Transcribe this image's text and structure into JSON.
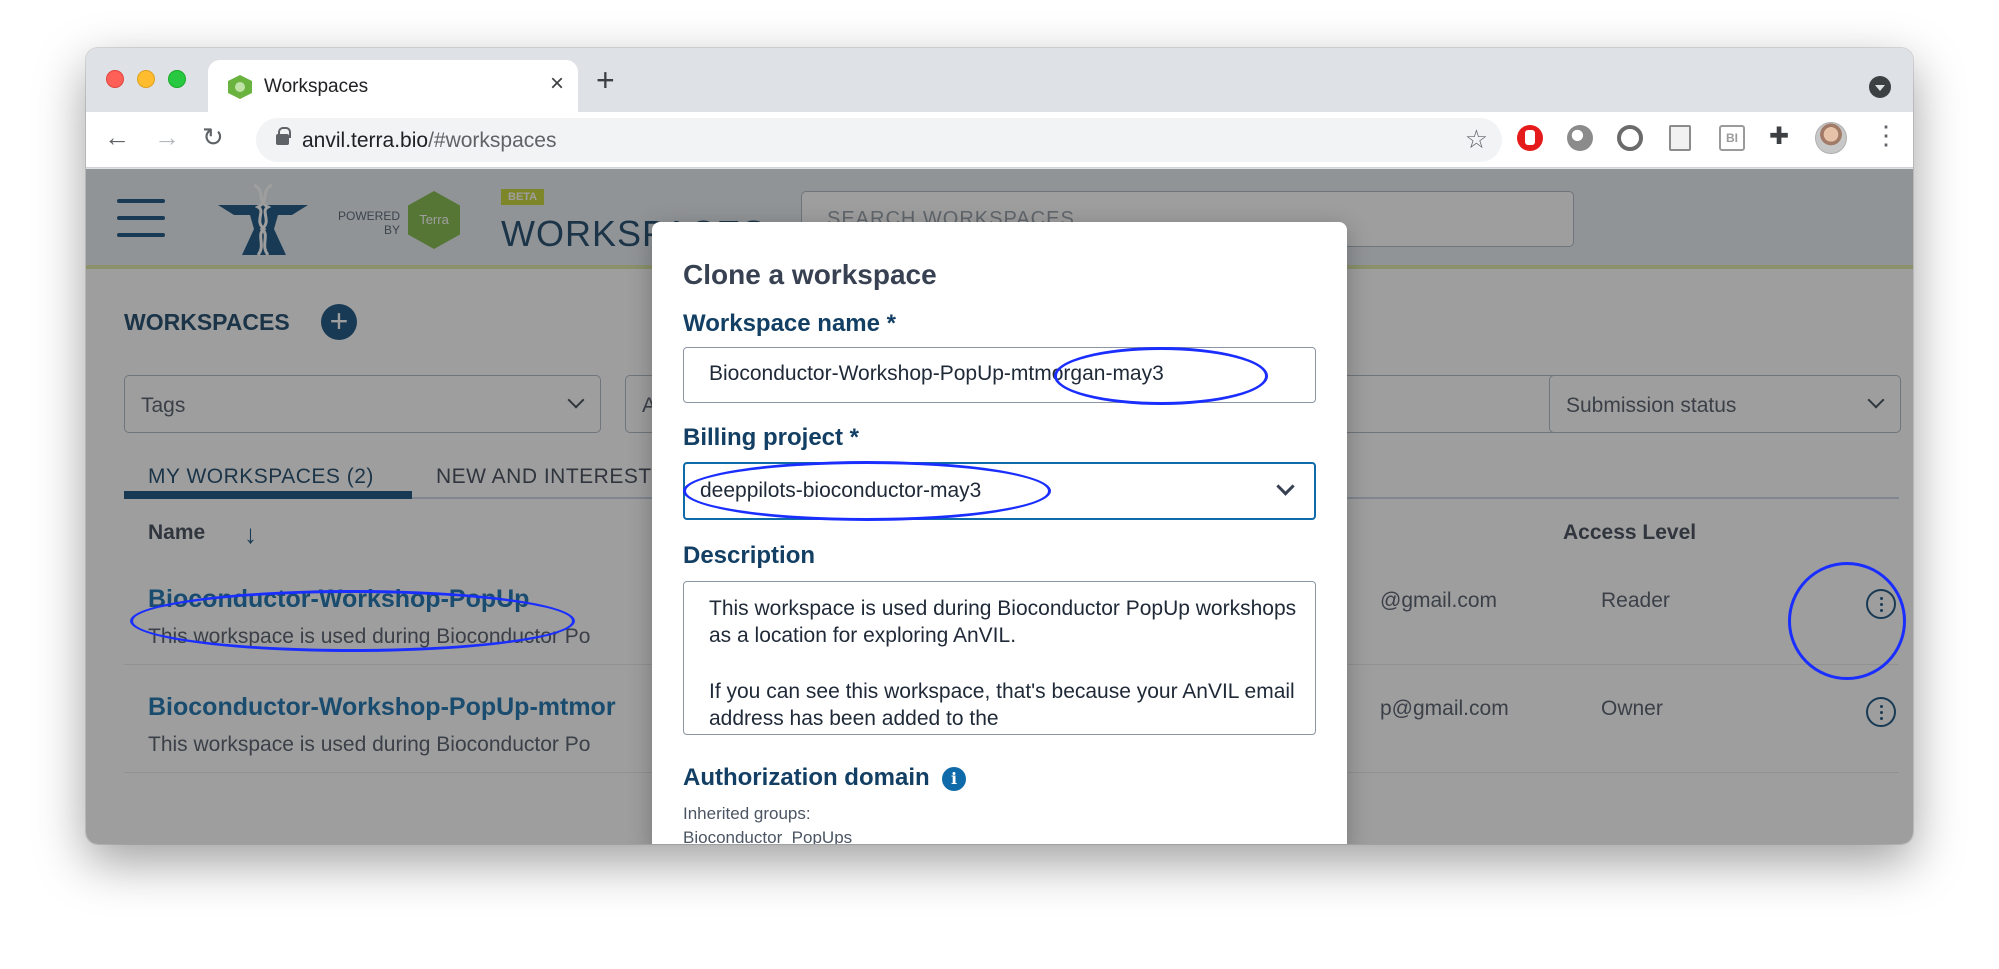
{
  "browser": {
    "tab_title": "Workspaces",
    "url_host": "anvil.terra.bio",
    "url_path": "/#workspaces",
    "icons": [
      "back-icon",
      "forward-icon",
      "reload-icon",
      "lock-icon",
      "star-icon",
      "puzzle-icon",
      "kebab-menu-icon"
    ]
  },
  "app": {
    "powered_by": "POWERED BY",
    "terra_label": "Terra",
    "beta_label": "BETA",
    "section_title": "WORKSPACES",
    "search_placeholder": "SEARCH WORKSPACES",
    "workspaces_heading": "WORKSPACES",
    "filters": [
      "Tags",
      "A",
      "Submission status"
    ],
    "tabs": [
      "MY WORKSPACES (2)",
      "NEW AND INTEREST"
    ],
    "columns": {
      "name": "Name",
      "access": "Access Level"
    },
    "rows": [
      {
        "name": "Bioconductor-Workshop-PopUp",
        "description": "This workspace is used during Bioconductor Po",
        "email": "@gmail.com",
        "access": "Reader"
      },
      {
        "name": "Bioconductor-Workshop-PopUp-mtmor",
        "description": "This workspace is used during Bioconductor Po",
        "email": "p@gmail.com",
        "access": "Owner"
      }
    ]
  },
  "modal": {
    "title": "Clone a workspace",
    "name_label": "Workspace name *",
    "name_value": "Bioconductor-Workshop-PopUp-mtmorgan-may3",
    "billing_label": "Billing project *",
    "billing_value": "deeppilots-bioconductor-may3",
    "description_label": "Description",
    "description_p1": "This workspace is used during Bioconductor PopUp workshops as a location for exploring AnVIL.",
    "description_p2": "If you can see this workspace, that's because your AnVIL email address has been added to the",
    "auth_label": "Authorization domain",
    "inherited_label": "Inherited groups:",
    "inherited_value": "Bioconductor_PopUps"
  },
  "colors": {
    "annotation": "#1a2eff",
    "primary": "#0e4a78",
    "link": "#0e6aa8"
  }
}
